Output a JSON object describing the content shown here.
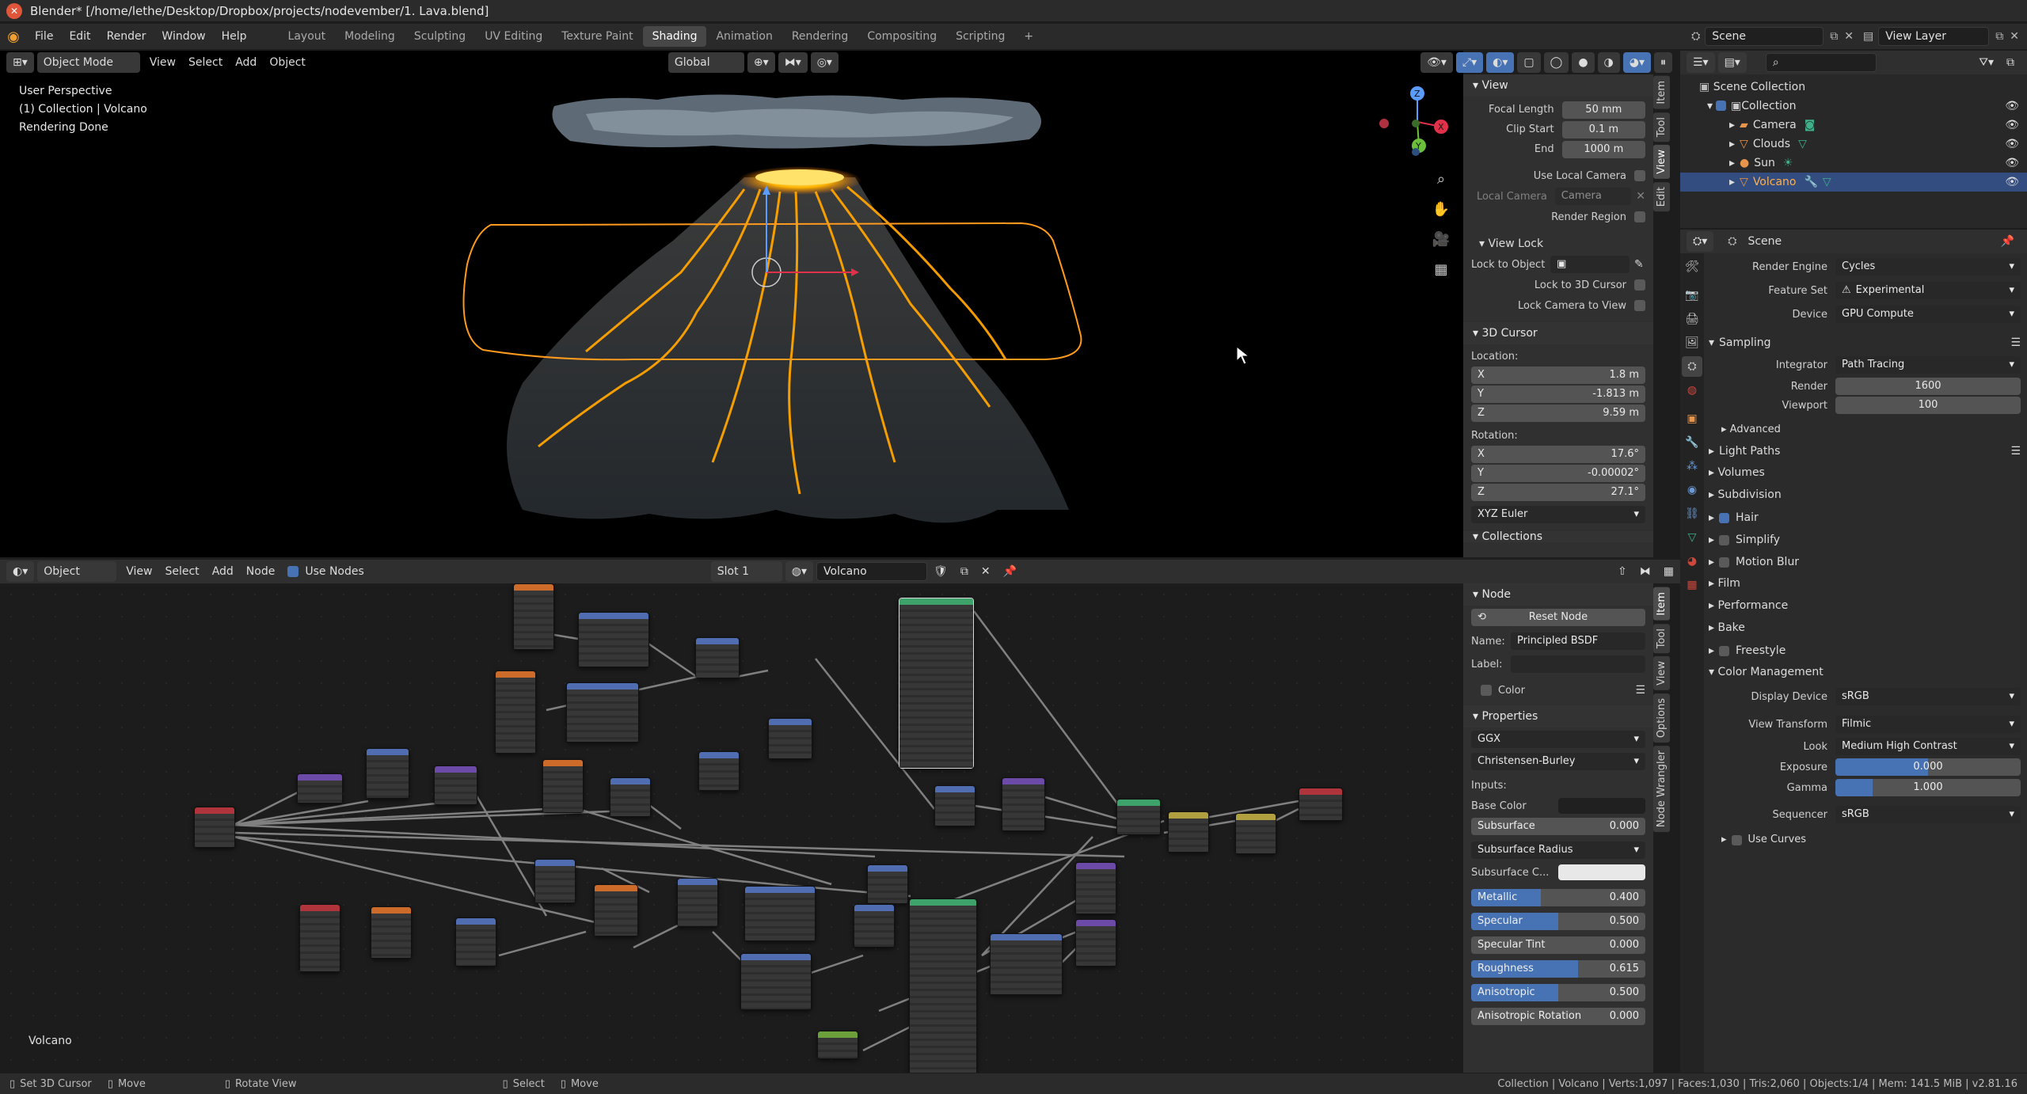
{
  "window": {
    "title": "Blender* [/home/lethe/Desktop/Dropbox/projects/nodevember/1. Lava.blend]"
  },
  "menu": {
    "items": [
      "File",
      "Edit",
      "Render",
      "Window",
      "Help"
    ]
  },
  "workspaces": {
    "tabs": [
      "Layout",
      "Modeling",
      "Sculpting",
      "UV Editing",
      "Texture Paint",
      "Shading",
      "Animation",
      "Rendering",
      "Compositing",
      "Scripting"
    ],
    "active": "Shading",
    "add": "+"
  },
  "scene": {
    "name": "Scene",
    "view_layer": "View Layer"
  },
  "viewport": {
    "mode": "Object Mode",
    "menus": [
      "View",
      "Select",
      "Add",
      "Object"
    ],
    "orientation": "Global",
    "overlay": {
      "line1": "User Perspective",
      "line2": "(1) Collection | Volcano",
      "line3": "Rendering Done"
    },
    "gizmo": {
      "x": "X",
      "y": "Y",
      "z": "Z"
    }
  },
  "view_panel": {
    "title": "View",
    "focal_length_label": "Focal Length",
    "focal_length": "50 mm",
    "clip_start_label": "Clip Start",
    "clip_start": "0.1 m",
    "end_label": "End",
    "end": "1000 m",
    "use_local_camera": "Use Local Camera",
    "local_camera_label": "Local Camera",
    "local_camera": "Camera",
    "render_region": "Render Region",
    "view_lock": "View Lock",
    "lock_to_object": "Lock to Object",
    "lock_to_cursor": "Lock to 3D Cursor",
    "lock_camera": "Lock Camera to View",
    "cursor_title": "3D Cursor",
    "location_label": "Location:",
    "loc": [
      {
        "axis": "X",
        "value": "1.8 m"
      },
      {
        "axis": "Y",
        "value": "-1.813 m"
      },
      {
        "axis": "Z",
        "value": "9.59 m"
      }
    ],
    "rotation_label": "Rotation:",
    "rot": [
      {
        "axis": "X",
        "value": "17.6°"
      },
      {
        "axis": "Y",
        "value": "-0.00002°"
      },
      {
        "axis": "Z",
        "value": "27.1°"
      }
    ],
    "rotation_mode": "XYZ Euler",
    "collections": "Collections"
  },
  "viewport_tabs": [
    "Item",
    "Tool",
    "View",
    "Edit"
  ],
  "node_editor": {
    "mode": "Object",
    "menus": [
      "View",
      "Select",
      "Add",
      "Node"
    ],
    "use_nodes": "Use Nodes",
    "slot": "Slot 1",
    "material": "Volcano",
    "frame_label": "Volcano"
  },
  "node_panel": {
    "title": "Node",
    "reset": "Reset Node",
    "name_label": "Name:",
    "name": "Principled BSDF",
    "label_label": "Label:",
    "color": "Color",
    "properties": "Properties",
    "distribution": "GGX",
    "subsurface_method": "Christensen-Burley",
    "inputs_label": "Inputs:",
    "base_color": "Base Color",
    "subsurface": {
      "label": "Subsurface",
      "value": "0.000",
      "fill": 0
    },
    "subsurface_radius": "Subsurface Radius",
    "subsurface_color": "Subsurface C...",
    "metallic": {
      "label": "Metallic",
      "value": "0.400",
      "fill": 0.4
    },
    "specular": {
      "label": "Specular",
      "value": "0.500",
      "fill": 0.5
    },
    "specular_tint": {
      "label": "Specular Tint",
      "value": "0.000",
      "fill": 0
    },
    "roughness": {
      "label": "Roughness",
      "value": "0.615",
      "fill": 0.615
    },
    "anisotropic": {
      "label": "Anisotropic",
      "value": "0.500",
      "fill": 0.5
    },
    "anisotropic_rotation": {
      "label": "Anisotropic Rotation",
      "value": "0.000",
      "fill": 0
    }
  },
  "node_tabs": [
    "Item",
    "Tool",
    "View",
    "Options",
    "Node Wrangler"
  ],
  "outliner": {
    "root": "Scene Collection",
    "collection": "Collection",
    "items": [
      "Camera",
      "Clouds",
      "Sun",
      "Volcano"
    ],
    "selected": "Volcano"
  },
  "properties": {
    "context": "Scene",
    "render_engine_label": "Render Engine",
    "render_engine": "Cycles",
    "feature_set_label": "Feature Set",
    "feature_set": "Experimental",
    "device_label": "Device",
    "device": "GPU Compute",
    "sampling": "Sampling",
    "integrator_label": "Integrator",
    "integrator": "Path Tracing",
    "render_label": "Render",
    "render_samples": "1600",
    "viewport_label": "Viewport",
    "viewport_samples": "100",
    "advanced": "Advanced",
    "light_paths": "Light Paths",
    "volumes": "Volumes",
    "subdivision": "Subdivision",
    "hair": "Hair",
    "simplify": "Simplify",
    "motion_blur": "Motion Blur",
    "film": "Film",
    "performance": "Performance",
    "bake": "Bake",
    "freestyle": "Freestyle",
    "color_management": "Color Management",
    "display_device_label": "Display Device",
    "display_device": "sRGB",
    "view_transform_label": "View Transform",
    "view_transform": "Filmic",
    "look_label": "Look",
    "look": "Medium High Contrast",
    "exposure_label": "Exposure",
    "exposure": "0.000",
    "gamma_label": "Gamma",
    "gamma": "1.000",
    "sequencer_label": "Sequencer",
    "sequencer": "sRGB",
    "use_curves": "Use Curves"
  },
  "status": {
    "set_cursor": "Set 3D Cursor",
    "move": "Move",
    "rotate": "Rotate View",
    "select": "Select",
    "move2": "Move",
    "info": "Collection | Volcano | Verts:1,097 | Faces:1,030 | Tris:2,060 | Objects:1/4 | Mem: 141.5 MiB | v2.81.16"
  },
  "colors": {
    "accent": "#4772b3",
    "selection": "#334d80",
    "lava": "#ffb400",
    "select_outline": "#ff9a1f"
  }
}
